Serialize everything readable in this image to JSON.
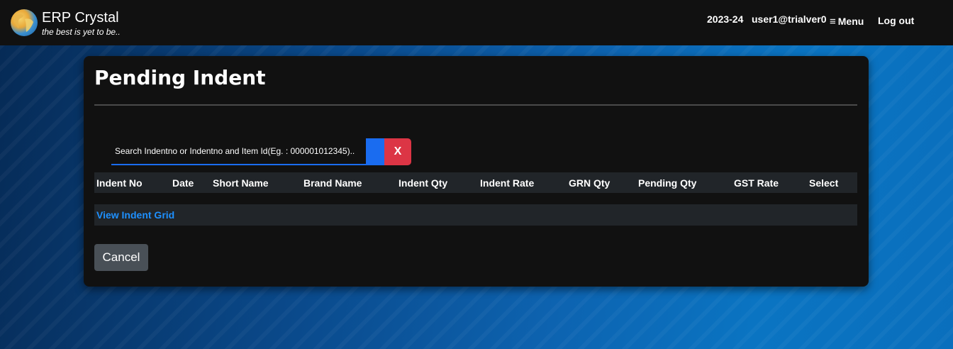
{
  "brand": {
    "title": "ERP Crystal",
    "tagline": "the best is yet to be.."
  },
  "nav": {
    "year": "2023-24",
    "user": "user1@trialver0",
    "menu_icon": "hamburger-icon",
    "menu_label": "Menu",
    "logout_label": "Log out"
  },
  "page": {
    "title": "Pending Indent"
  },
  "search": {
    "placeholder": "Search Indentno or Indentno and Item Id(Eg. : 000001012345)..",
    "clear_label": "X"
  },
  "table": {
    "columns": [
      "Indent No",
      "Date",
      "Short Name",
      "Brand Name",
      "Indent Qty",
      "Indent Rate",
      "GRN Qty",
      "Pending Qty",
      "GST Rate",
      "Select"
    ]
  },
  "grid_link": "View Indent Grid",
  "actions": {
    "cancel_label": "Cancel"
  },
  "colors": {
    "primary": "#1a6cf0",
    "danger": "#dc3545",
    "link": "#1e90ff",
    "secondary": "#495057"
  }
}
